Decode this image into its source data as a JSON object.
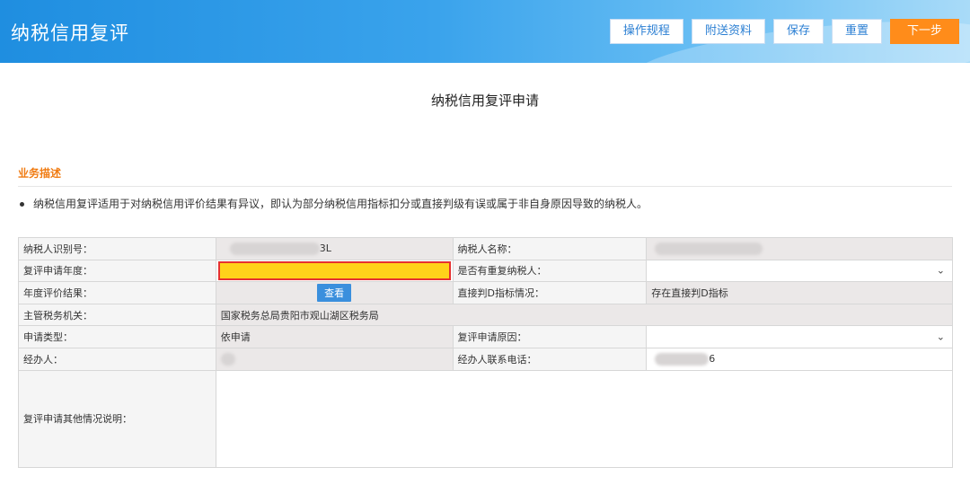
{
  "app": {
    "title": "纳税信用复评"
  },
  "toolbar": {
    "buttons": [
      "操作规程",
      "附送资料",
      "保存",
      "重置",
      "下一步"
    ]
  },
  "page": {
    "title": "纳税信用复评申请"
  },
  "section": {
    "heading": "业务描述",
    "description": "纳税信用复评适用于对纳税信用评价结果有异议，即认为部分纳税信用指标扣分或直接判级有误或属于非自身原因导致的纳税人。"
  },
  "form": {
    "taxpayer_id_label": "纳税人识别号：",
    "taxpayer_id_value": "3L",
    "taxpayer_name_label": "纳税人名称：",
    "review_year_label": "复评申请年度：",
    "review_year_value": "",
    "duplicate_label": "是否有重复纳税人：",
    "duplicate_value": "",
    "annual_result_label": "年度评价结果：",
    "view_button": "查看",
    "direct_d_label": "直接判D指标情况：",
    "direct_d_value": "存在直接判D指标",
    "tax_office_label": "主管税务机关：",
    "tax_office_value": "国家税务总局贵阳市观山湖区税务局",
    "apply_type_label": "申请类型：",
    "apply_type_value": "依申请",
    "review_reason_label": "复评申请原因：",
    "review_reason_value": "",
    "handler_label": "经办人：",
    "handler_phone_label": "经办人联系电话：",
    "handler_phone_value": "6",
    "other_label": "复评申请其他情况说明："
  }
}
